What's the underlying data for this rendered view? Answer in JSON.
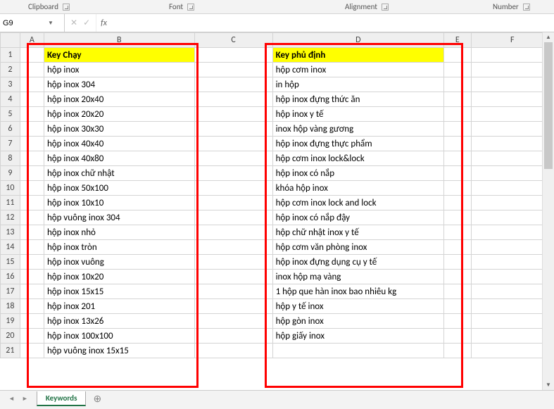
{
  "ribbon": {
    "groups": {
      "clipboard": "Clipboard",
      "font": "Font",
      "alignment": "Alignment",
      "number": "Number"
    }
  },
  "namebox": {
    "value": "G9"
  },
  "formula_bar": {
    "fx_label": "fx",
    "value": ""
  },
  "columns": [
    "A",
    "B",
    "C",
    "D",
    "E",
    "F"
  ],
  "row_numbers": [
    1,
    2,
    3,
    4,
    5,
    6,
    7,
    8,
    9,
    10,
    11,
    12,
    13,
    14,
    15,
    16,
    17,
    18,
    19,
    20,
    21
  ],
  "headers": {
    "b": "Key Chạy",
    "d": "Key phủ định"
  },
  "col_b": [
    "hộp inox",
    "hộp inox 304",
    "hộp inox 20x40",
    "hộp inox 20x20",
    "hộp inox 30x30",
    "hộp inox 40x40",
    "hộp inox 40x80",
    "hộp inox chữ nhật",
    "hộp inox 50x100",
    "hộp inox 10x10",
    "hộp vuông inox 304",
    "hộp inox nhỏ",
    "hộp inox tròn",
    "hộp inox vuông",
    "hộp inox 10x20",
    "hộp inox 15x15",
    "hộp inox 201",
    "hộp inox 13x26",
    "hộp inox 100x100",
    "hộp vuông inox 15x15"
  ],
  "col_d": [
    "hộp cơm inox",
    "in hộp",
    "hộp inox đựng thức ăn",
    "hộp inox y tế",
    "inox hộp vàng gương",
    "hộp inox đựng thực phẩm",
    "hộp cơm inox lock&lock",
    "hộp inox có nắp",
    "khóa hộp inox",
    "hộp cơm inox lock and lock",
    "hộp inox có nắp đậy",
    "hộp chữ nhật inox y tế",
    "hộp cơm văn phòng inox",
    "hộp inox đựng dụng cụ y tế",
    "inox hộp mạ vàng",
    "1 hộp que hàn inox bao nhiêu kg",
    "hộp y tế inox",
    "hộp gòn inox",
    "hộp giấy inox",
    ""
  ],
  "sheet_tab": "Keywords",
  "chart_data": {
    "type": "table",
    "title": "Keywords spreadsheet",
    "columns": [
      "Key Chạy",
      "Key phủ định"
    ],
    "rows": [
      [
        "hộp inox",
        "hộp cơm inox"
      ],
      [
        "hộp inox 304",
        "in hộp"
      ],
      [
        "hộp inox 20x40",
        "hộp inox đựng thức ăn"
      ],
      [
        "hộp inox 20x20",
        "hộp inox y tế"
      ],
      [
        "hộp inox 30x30",
        "inox hộp vàng gương"
      ],
      [
        "hộp inox 40x40",
        "hộp inox đựng thực phẩm"
      ],
      [
        "hộp inox 40x80",
        "hộp cơm inox lock&lock"
      ],
      [
        "hộp inox chữ nhật",
        "hộp inox có nắp"
      ],
      [
        "hộp inox 50x100",
        "khóa hộp inox"
      ],
      [
        "hộp inox 10x10",
        "hộp cơm inox lock and lock"
      ],
      [
        "hộp vuông inox 304",
        "hộp inox có nắp đậy"
      ],
      [
        "hộp inox nhỏ",
        "hộp chữ nhật inox y tế"
      ],
      [
        "hộp inox tròn",
        "hộp cơm văn phòng inox"
      ],
      [
        "hộp inox vuông",
        "hộp inox đựng dụng cụ y tế"
      ],
      [
        "hộp inox 10x20",
        "inox hộp mạ vàng"
      ],
      [
        "hộp inox 15x15",
        "1 hộp que hàn inox bao nhiêu kg"
      ],
      [
        "hộp inox 201",
        "hộp y tế inox"
      ],
      [
        "hộp inox 13x26",
        "hộp gòn inox"
      ],
      [
        "hộp inox 100x100",
        "hộp giấy inox"
      ],
      [
        "hộp vuông inox 15x15",
        ""
      ]
    ]
  }
}
